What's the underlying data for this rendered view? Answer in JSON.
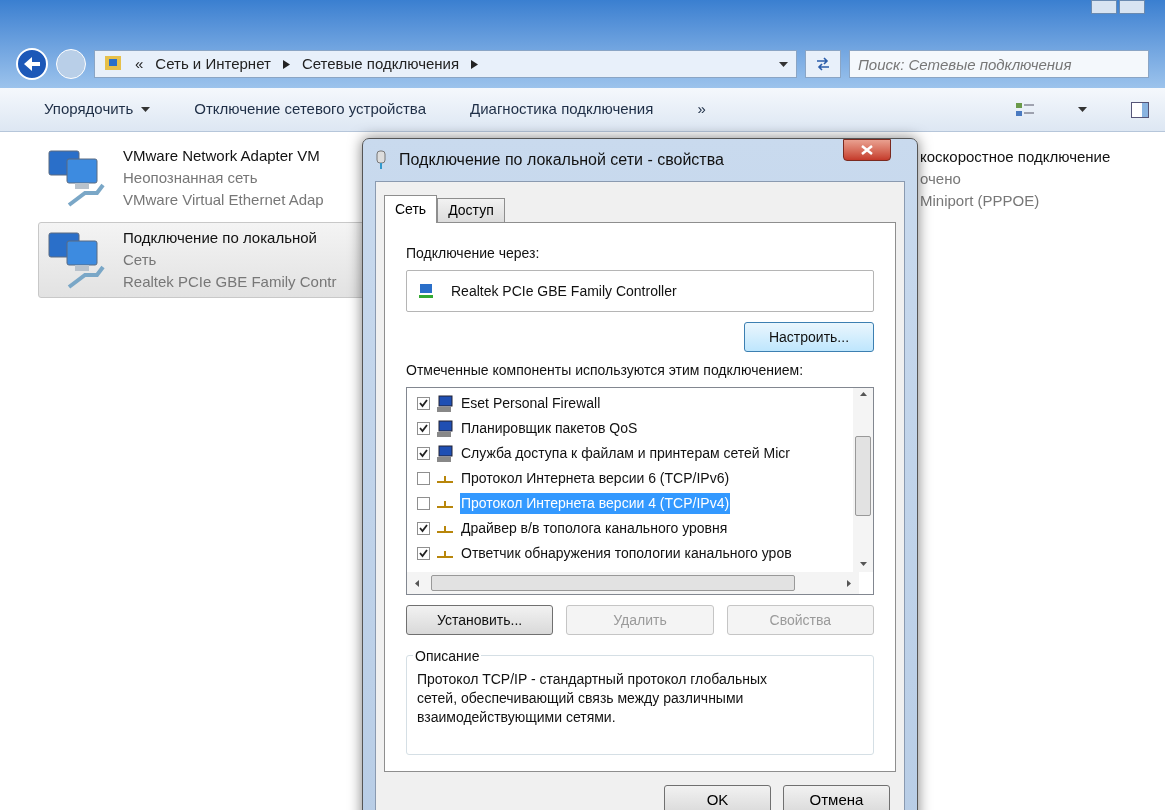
{
  "explorer": {
    "address": {
      "prefix": "«",
      "crumbs": [
        "Сеть и Интернет",
        "Сетевые подключения"
      ]
    },
    "search": {
      "placeholder": "Поиск: Сетевые подключения"
    },
    "toolbar": [
      {
        "label": "Упорядочить",
        "dropdown": true
      },
      {
        "label": "Отключение сетевого устройства",
        "dropdown": false
      },
      {
        "label": "Диагностика подключения",
        "dropdown": false
      },
      {
        "label": "»",
        "dropdown": false
      }
    ],
    "connections": [
      {
        "name": "VMware Network Adapter VM",
        "status": "Неопознанная сеть",
        "device": "VMware Virtual Ethernet Adap",
        "selected": false
      },
      {
        "name": "Подключение по локальной",
        "status": "Сеть",
        "device": "Realtek PCIe GBE Family Contr",
        "selected": true
      }
    ],
    "partial_connection": {
      "name": "коскоростное подключение",
      "status": "очено",
      "device": "Miniport (PPPOE)"
    }
  },
  "dialog": {
    "title": "Подключение по локальной сети - свойства",
    "tabs": [
      {
        "label": "Сеть",
        "selected": true
      },
      {
        "label": "Доступ",
        "selected": false
      }
    ],
    "connect_label": "Подключение через:",
    "adapter": "Realtek PCIe GBE Family Controller",
    "configure_button": "Настроить...",
    "components_label": "Отмеченные компоненты используются этим подключением:",
    "components": [
      {
        "label": "Eset Personal Firewall",
        "kind": "service",
        "checked": true,
        "selected": false
      },
      {
        "label": "Планировщик пакетов QoS",
        "kind": "service",
        "checked": true,
        "selected": false
      },
      {
        "label": "Служба доступа к файлам и принтерам сетей Micr",
        "kind": "service",
        "checked": true,
        "selected": false
      },
      {
        "label": "Протокол Интернета версии 6 (TCP/IPv6)",
        "kind": "protocol",
        "checked": false,
        "selected": false
      },
      {
        "label": "Протокол Интернета версии 4 (TCP/IPv4)",
        "kind": "protocol",
        "checked": false,
        "selected": true
      },
      {
        "label": "Драйвер в/в тополога канального уровня",
        "kind": "protocol",
        "checked": true,
        "selected": false
      },
      {
        "label": "Ответчик обнаружения топологии канального уров",
        "kind": "protocol",
        "checked": true,
        "selected": false
      }
    ],
    "buttons": [
      {
        "label": "Установить...",
        "disabled": false
      },
      {
        "label": "Удалить",
        "disabled": true
      },
      {
        "label": "Свойства",
        "disabled": true
      }
    ],
    "description_title": "Описание",
    "description": "Протокол TCP/IP - стандартный протокол глобальных сетей, обеспечивающий связь между различными взаимодействующими сетями.",
    "footer_buttons": [
      "OK",
      "Отмена"
    ]
  }
}
